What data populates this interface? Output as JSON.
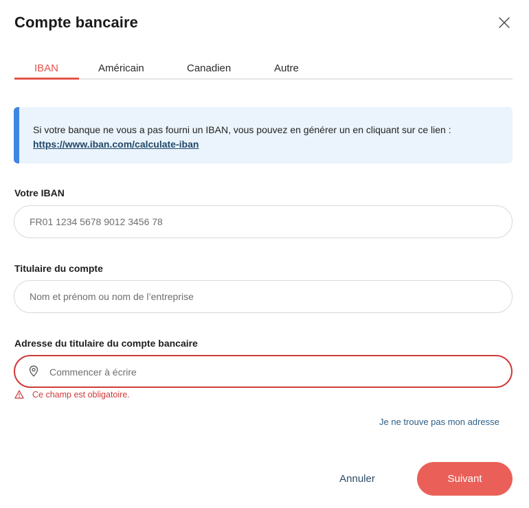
{
  "dialog": {
    "title": "Compte bancaire",
    "close_icon": "close-icon"
  },
  "tabs": [
    {
      "label": "IBAN",
      "active": true
    },
    {
      "label": "Américain",
      "active": false
    },
    {
      "label": "Canadien",
      "active": false
    },
    {
      "label": "Autre",
      "active": false
    }
  ],
  "info": {
    "text": "Si votre banque ne vous a pas fourni un IBAN, vous pouvez en générer un en cliquant sur ce lien : ",
    "link": "https://www.iban.com/calculate-iban"
  },
  "fields": {
    "iban": {
      "label": "Votre IBAN",
      "placeholder": "FR01 1234 5678 9012 3456 78"
    },
    "holder": {
      "label": "Titulaire du compte",
      "placeholder": "Nom et prénom ou nom de l’entreprise"
    },
    "address": {
      "label": "Adresse du titulaire du compte bancaire",
      "placeholder": "Commencer à écrire",
      "icon": "location-pin-icon",
      "error": "Ce champ est obligatoire.",
      "error_icon": "warning-icon"
    }
  },
  "address_not_found_link": "Je ne trouve pas mon adresse",
  "actions": {
    "cancel": "Annuler",
    "next": "Suivant"
  },
  "colors": {
    "accent": "#e5534b",
    "primary_button": "#ea6059",
    "info_bg": "#ebf4fc",
    "info_bar": "#3f86e2",
    "error": "#cf3a3a",
    "link": "#2b5c84"
  }
}
